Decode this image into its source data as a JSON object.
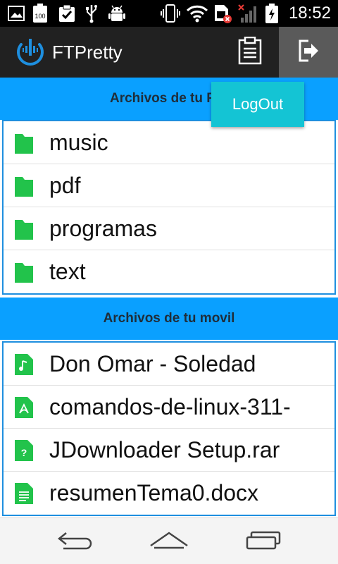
{
  "status_bar": {
    "time": "18:52",
    "battery_pct_label": "100",
    "icons_left": [
      "gallery-icon",
      "battery-100-icon",
      "clipboard-check-icon",
      "usb-icon",
      "android-debug-icon"
    ],
    "icons_right": [
      "vibrate-icon",
      "wifi-icon",
      "sim-error-icon",
      "signal-off-icon",
      "battery-charging-icon"
    ]
  },
  "action_bar": {
    "title": "FTPretty",
    "actions": [
      "clipboard-icon",
      "logout-icon"
    ]
  },
  "popup": {
    "label": "LogOut"
  },
  "sections": [
    {
      "header": "Archivos de tu PC",
      "header_visible": "Archivos de tu P",
      "items": [
        {
          "name": "music",
          "icon": "folder-icon"
        },
        {
          "name": "pdf",
          "icon": "folder-icon"
        },
        {
          "name": "programas",
          "icon": "folder-icon"
        },
        {
          "name": "text",
          "icon": "folder-icon"
        }
      ]
    },
    {
      "header": "Archivos de tu movil",
      "items": [
        {
          "name": "Don Omar - Soledad",
          "icon": "audio-file-icon"
        },
        {
          "name": "comandos-de-linux-311-",
          "icon": "pdf-file-icon"
        },
        {
          "name": "JDownloader Setup.rar",
          "icon": "unknown-file-icon"
        },
        {
          "name": "resumenTema0.docx",
          "icon": "document-file-icon"
        }
      ]
    }
  ],
  "colors": {
    "section_header": "#0aa0ff",
    "list_border": "#1e8fdf",
    "file_icon": "#22c34b",
    "popup": "#14c4d4",
    "action_bar": "#212121"
  },
  "nav_bar": {
    "buttons": [
      "back-icon",
      "home-icon",
      "recent-apps-icon"
    ]
  }
}
